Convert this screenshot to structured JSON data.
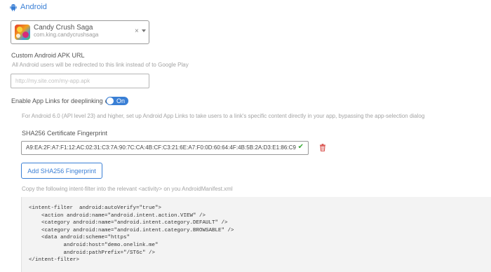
{
  "section": {
    "title": "Android",
    "icon": "android-icon"
  },
  "app_select": {
    "name": "Candy Crush Saga",
    "package": "com.king.candycrushsaga",
    "clear": "×"
  },
  "apk_url": {
    "label": "Custom Android APK URL",
    "help": "All Android users will be redirected to this link instead of to Google Play",
    "value": "",
    "placeholder": "http://my.site.com/my-app.apk"
  },
  "app_links": {
    "label": "Enable App Links for deeplinking",
    "toggle_label": "On",
    "toggle_state": "on",
    "help": "For Android 6.0 (API level 23) and higher, set up Android App Links to take users to a link's specific content directly in your app, bypassing the app-selection dialog"
  },
  "sha256": {
    "label": "SHA256 Certificate Fingerprint",
    "value": "A9:EA:2F:A7:F1:12:AC:02:31:C3:7A:90:7C:CA:4B:CF:C3:21:6E:A7:F0:0D:60:64:4F:4B:5B:2A:D3:E1:86:C9",
    "valid_icon": "check-icon",
    "add_button": "Add SHA256 Fingerprint"
  },
  "manifest": {
    "instruction": "Copy the following intent-filter into the relevant <activity> on you AndroidManifest.xml",
    "code": "<intent-filter  android:autoVerify=\"true\">\n    <action android:name=\"android.intent.action.VIEW\" />\n    <category android:name=\"android.intent.category.DEFAULT\" />\n    <category android:name=\"android.intent.category.BROWSABLE\" />\n    <data android:scheme=\"https\"\n           android:host=\"demo.onelink.me\"\n           android:pathPrefix=\"/ST6c\" />\n</intent-filter>"
  },
  "colors": {
    "accent": "#3a7fd5",
    "valid": "#39a935",
    "danger": "#d9534f"
  }
}
